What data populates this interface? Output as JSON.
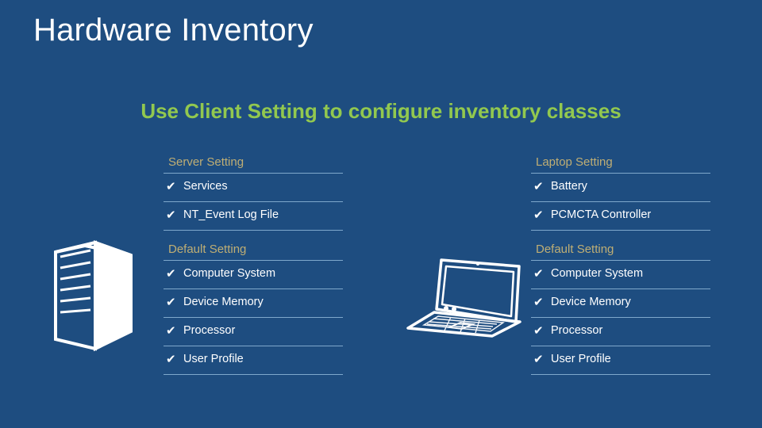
{
  "slide": {
    "title": "Hardware Inventory",
    "subtitle": "Use Client Setting to configure inventory classes",
    "background_color": "#1e4d80",
    "title_color": "#ffffff",
    "subtitle_color": "#92c84f",
    "header_color": "#bfae74",
    "rule_color": "#7fa8cc",
    "check_glyph": "✔"
  },
  "columns": [
    {
      "id": "server-column",
      "artwork": "server-tower-icon",
      "groups": [
        {
          "header": "Server Setting",
          "items": [
            {
              "label": "Services",
              "checked": true
            },
            {
              "label": "NT_Event Log File",
              "checked": true
            }
          ]
        },
        {
          "header": "Default Setting",
          "items": [
            {
              "label": "Computer System",
              "checked": true
            },
            {
              "label": "Device Memory",
              "checked": true
            },
            {
              "label": "Processor",
              "checked": true
            },
            {
              "label": "User Profile",
              "checked": true
            }
          ]
        }
      ]
    },
    {
      "id": "laptop-column",
      "artwork": "laptop-icon",
      "groups": [
        {
          "header": "Laptop Setting",
          "items": [
            {
              "label": "Battery",
              "checked": true
            },
            {
              "label": "PCMCTA Controller",
              "checked": true
            }
          ]
        },
        {
          "header": "Default Setting",
          "items": [
            {
              "label": "Computer System",
              "checked": true
            },
            {
              "label": "Device Memory",
              "checked": true
            },
            {
              "label": "Processor",
              "checked": true
            },
            {
              "label": "User Profile",
              "checked": true
            }
          ]
        }
      ]
    }
  ]
}
